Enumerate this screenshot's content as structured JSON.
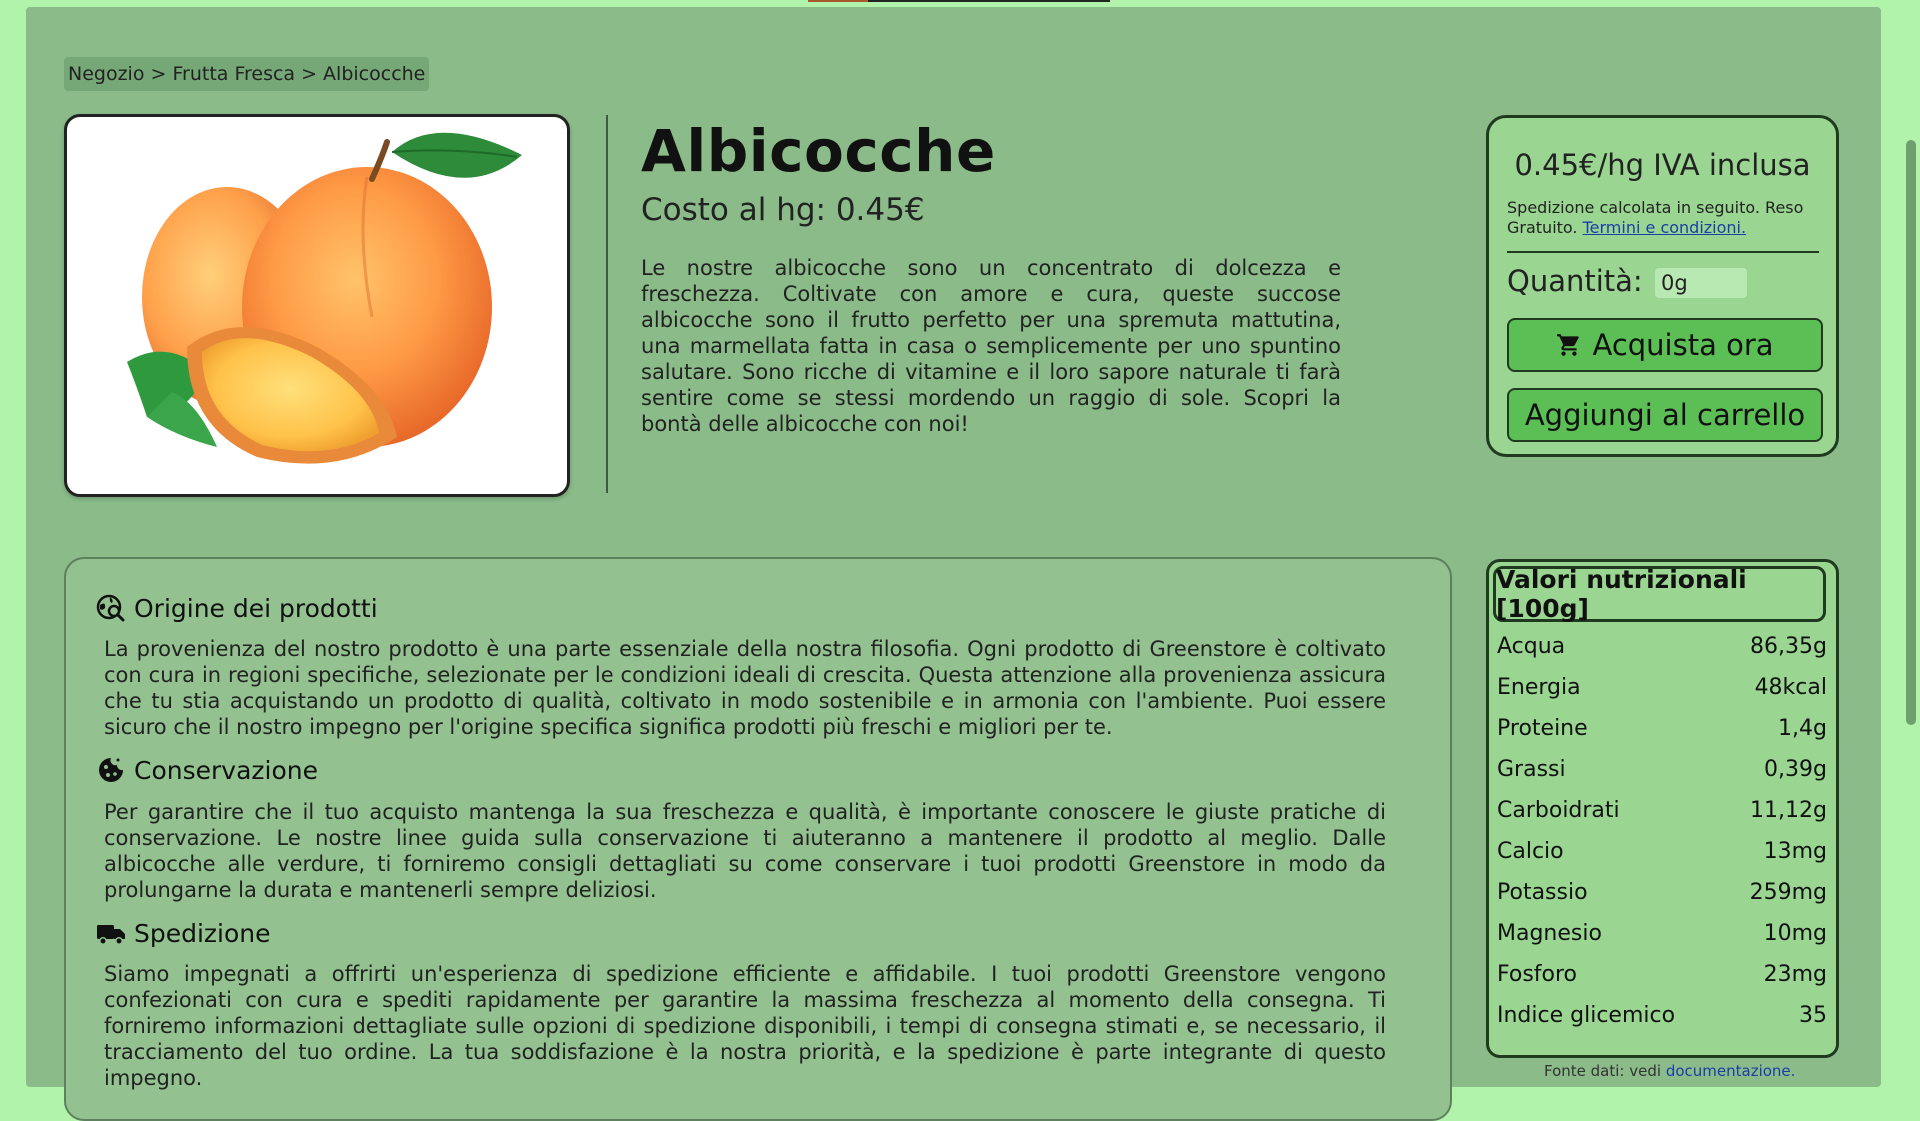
{
  "breadcrumb": "Negozio > Frutta Fresca > Albicocche",
  "product": {
    "title": "Albicocche",
    "subtitle": "Costo al hg: 0.45€",
    "description": "Le nostre albicocche sono un concentrato di dolcezza e freschezza. Coltivate con amore e cura, queste succose albicocche sono il frutto perfetto per una spremuta mattutina, una marmellata fatta in casa o semplicemente per uno spuntino salutare. Sono ricche di vitamine e il loro sapore naturale ti farà sentire come se stessi mordendo un raggio di sole. Scopri la bontà delle albicocche con noi!"
  },
  "buy": {
    "price": "0.45€/hg IVA inclusa",
    "note": "Spedizione calcolata in seguito. Reso Gratuito.",
    "terms_link": "Termini e condizioni.",
    "quantity_label": "Quantità:",
    "quantity_value": "0g",
    "buy_label": "Acquista ora",
    "cart_label": "Aggiungi al carrello"
  },
  "info": {
    "origin_title": "Origine dei prodotti",
    "origin_text": "La provenienza del nostro prodotto è una parte essenziale della nostra filosofia. Ogni prodotto di Greenstore è coltivato con cura in regioni specifiche, selezionate per le condizioni ideali di crescita. Questa attenzione alla provenienza assicura che tu stia acquistando un prodotto di qualità, coltivato in modo sostenibile e in armonia con l'ambiente. Puoi essere sicuro che il nostro impegno per l'origine specifica significa prodotti più freschi e migliori per te.",
    "conservation_title": "Conservazione",
    "conservation_text": "Per garantire che il tuo acquisto mantenga la sua freschezza e qualità, è importante conoscere le giuste pratiche di conservazione. Le nostre linee guida sulla conservazione ti aiuteranno a mantenere il prodotto al meglio. Dalle albicocche alle verdure, ti forniremo consigli dettagliati su come conservare i tuoi prodotti Greenstore in modo da prolungarne la durata e mantenerli sempre deliziosi.",
    "shipping_title": "Spedizione",
    "shipping_text": "Siamo impegnati a offrirti un'esperienza di spedizione efficiente e affidabile. I tuoi prodotti Greenstore vengono confezionati con cura e spediti rapidamente per garantire la massima freschezza al momento della consegna. Ti forniremo informazioni dettagliate sulle opzioni di spedizione disponibili, i tempi di consegna stimati e, se necessario, il tracciamento del tuo ordine. La tua soddisfazione è la nostra priorità, e la spedizione è parte integrante di questo impegno."
  },
  "nutrition": {
    "title": "Valori nutrizionali [100g]",
    "rows": [
      {
        "name": "Acqua",
        "value": "86,35g"
      },
      {
        "name": "Energia",
        "value": "48kcal"
      },
      {
        "name": "Proteine",
        "value": "1,4g"
      },
      {
        "name": "Grassi",
        "value": "0,39g"
      },
      {
        "name": "Carboidrati",
        "value": "11,12g"
      },
      {
        "name": "Calcio",
        "value": "13mg"
      },
      {
        "name": "Potassio",
        "value": "259mg"
      },
      {
        "name": "Magnesio",
        "value": "10mg"
      },
      {
        "name": "Fosforo",
        "value": "23mg"
      },
      {
        "name": "Indice glicemico",
        "value": "35"
      }
    ],
    "source_prefix": "Fonte dati: vedi",
    "source_link": "documentazione."
  },
  "colors": {
    "page_bg": "#b2f3ac",
    "panel_bg": "#8abb89",
    "button_bg": "#5cbf56",
    "box_bg": "#9ad692"
  }
}
